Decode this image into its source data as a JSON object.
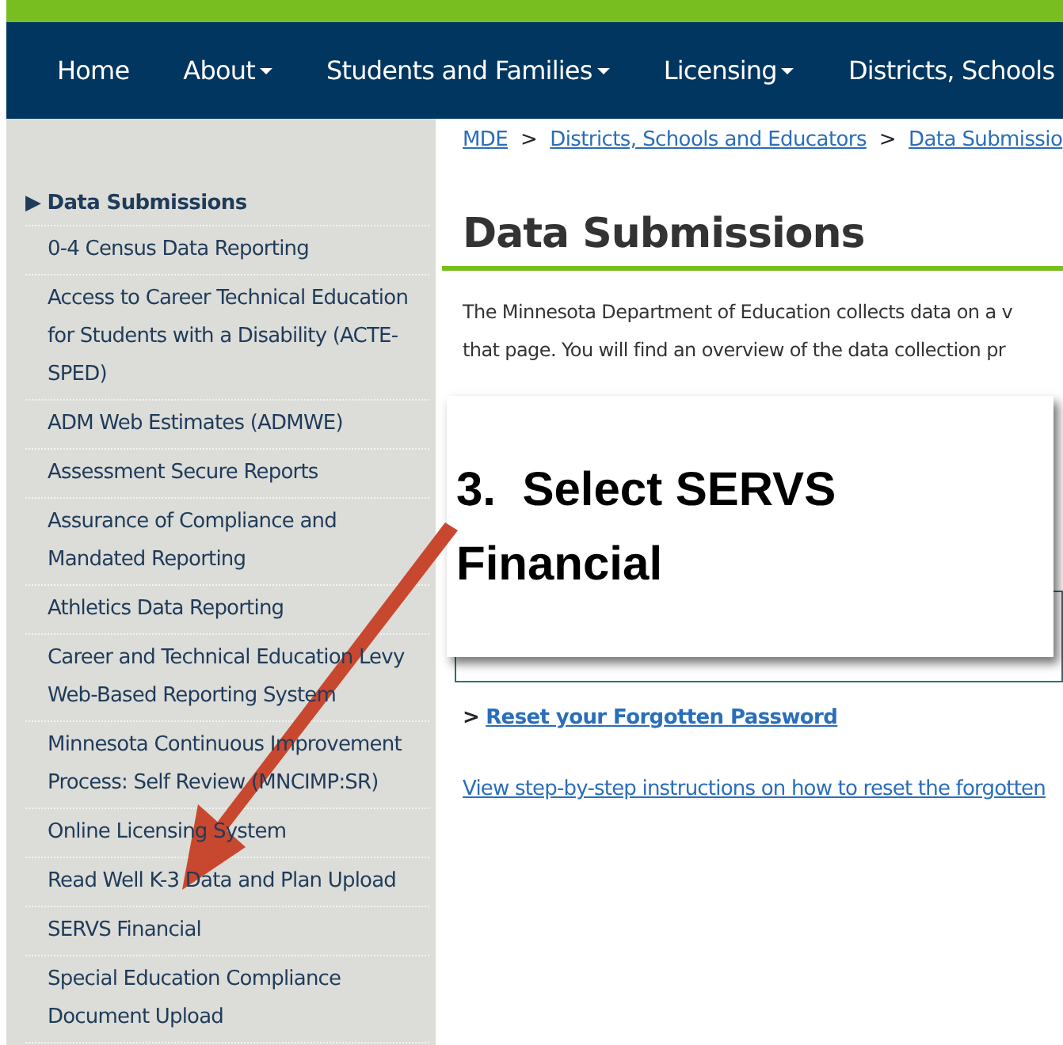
{
  "nav": [
    {
      "label": "Home",
      "dropdown": false
    },
    {
      "label": "About",
      "dropdown": true
    },
    {
      "label": "Students and Families",
      "dropdown": true
    },
    {
      "label": "Licensing",
      "dropdown": true
    },
    {
      "label": "Districts, Schools",
      "dropdown": false
    }
  ],
  "sidebar": {
    "marker": "▶",
    "title": "Data Submissions",
    "items": [
      "0-4 Census Data Reporting",
      "Access to Career Technical Education for Students with a Disability (ACTE-SPED)",
      "ADM Web Estimates (ADMWE)",
      "Assessment Secure Reports",
      "Assurance of Compliance and Mandated Reporting",
      "Athletics Data Reporting",
      "Career and Technical Education Levy Web-Based Reporting System",
      "Minnesota Continuous Improvement Process: Self Review (MNCIMP:SR)",
      "Online Licensing System",
      "Read Well K-3 Data and Plan Upload",
      "SERVS Financial",
      "Special Education Compliance Document Upload"
    ]
  },
  "breadcrumb": {
    "separator": ">",
    "links": [
      "MDE",
      "Districts, Schools and Educators",
      "Data Submissio"
    ]
  },
  "heading": "Data Submissions",
  "intro": [
    "The Minnesota Department of Education collects data on a v",
    "that page. You will find an overview of the data collection pr"
  ],
  "callout": {
    "text": "3.  Select SERVS Financial"
  },
  "reset": {
    "marker": ">",
    "link": "Reset your Forgotten Password"
  },
  "instructions_link": "View step-by-step instructions on how to reset the forgotten"
}
